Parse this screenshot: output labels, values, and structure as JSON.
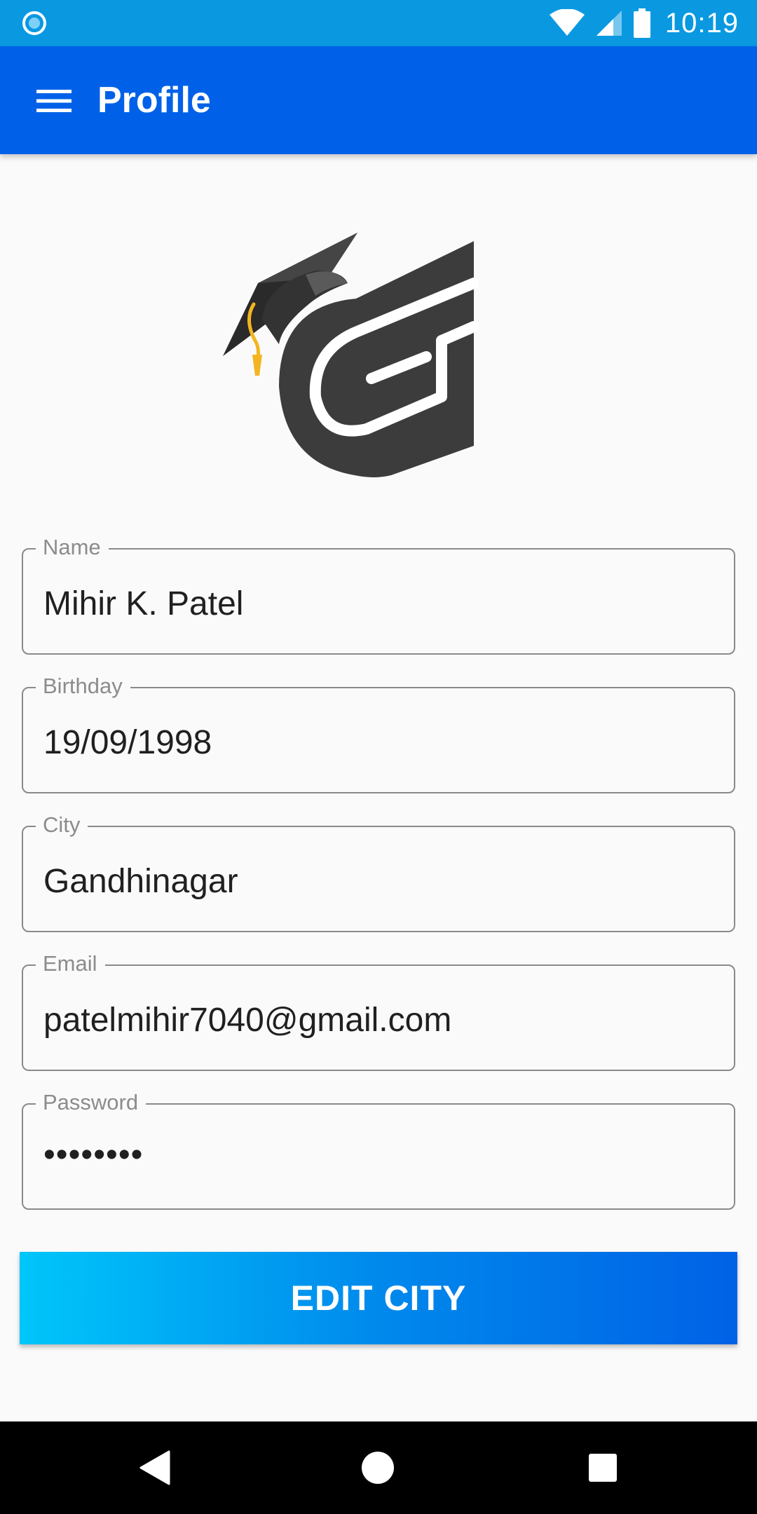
{
  "status_bar": {
    "time": "10:19",
    "icons": [
      "app-notification-icon",
      "wifi-icon",
      "cell-signal-icon",
      "battery-icon"
    ]
  },
  "app_bar": {
    "title": "Profile",
    "menu_icon": "hamburger-menu-icon"
  },
  "logo": {
    "icon": "graduation-cap-logo"
  },
  "form": {
    "fields": [
      {
        "label": "Name",
        "value": "Mihir K. Patel"
      },
      {
        "label": "Birthday",
        "value": "19/09/1998"
      },
      {
        "label": "City",
        "value": "Gandhinagar"
      },
      {
        "label": "Email",
        "value": "patelmihir7040@gmail.com"
      },
      {
        "label": "Password",
        "value": "••••••••"
      }
    ]
  },
  "edit_button": {
    "label": "EDIT CITY"
  },
  "nav_bar": {
    "icons": [
      "back-icon",
      "home-icon",
      "recents-icon"
    ]
  },
  "colors": {
    "status_bar": "#0a99e1",
    "app_bar": "#0061e8",
    "background": "#fafafa",
    "field_border": "#8a8a8a",
    "label": "#8c8c8c",
    "value_text": "#202020",
    "button_gradient_start": "#00c6fa",
    "button_gradient_end": "#0062e6",
    "logo_dark": "#3c3c3c",
    "tassel": "#f3b520"
  }
}
